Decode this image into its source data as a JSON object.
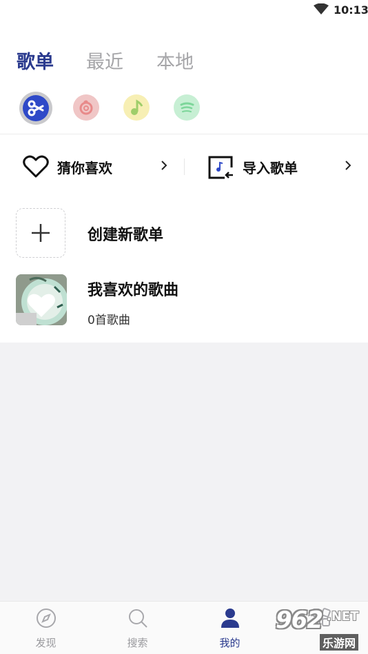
{
  "status_bar": {
    "time": "10:13",
    "wifi_icon": "wifi-icon"
  },
  "tabs": [
    {
      "label": "歌单",
      "active": true
    },
    {
      "label": "最近",
      "active": false
    },
    {
      "label": "本地",
      "active": false
    }
  ],
  "sources": [
    {
      "icon": "app-source-icon",
      "color": "#2e49c8",
      "selected": true
    },
    {
      "icon": "netease-music-icon",
      "color": "#f0c6c6",
      "selected": false
    },
    {
      "icon": "qq-music-icon",
      "color": "#f7efb4",
      "selected": false
    },
    {
      "icon": "spotify-icon",
      "color": "#c7efd4",
      "selected": false
    }
  ],
  "quick_actions": {
    "guess_like": {
      "label": "猜你喜欢",
      "icon": "heart-icon"
    },
    "import_playlist": {
      "label": "导入歌单",
      "icon": "import-music-icon"
    }
  },
  "playlists": {
    "create": {
      "title": "创建新歌单",
      "icon": "plus-icon"
    },
    "liked": {
      "title": "我喜欢的歌曲",
      "subtitle": "0首歌曲"
    }
  },
  "bottom_nav": [
    {
      "label": "发现",
      "icon": "compass-icon",
      "active": false
    },
    {
      "label": "搜索",
      "icon": "search-icon",
      "active": false
    },
    {
      "label": "我的",
      "icon": "user-icon",
      "active": true
    },
    {
      "label": "",
      "icon": "apps-icon",
      "active": false
    }
  ],
  "watermark": {
    "brand": "962",
    "suffix": ".NET",
    "sub": "乐游网"
  },
  "colors": {
    "accent": "#2a3a8e",
    "background": "#f2f2f4"
  }
}
